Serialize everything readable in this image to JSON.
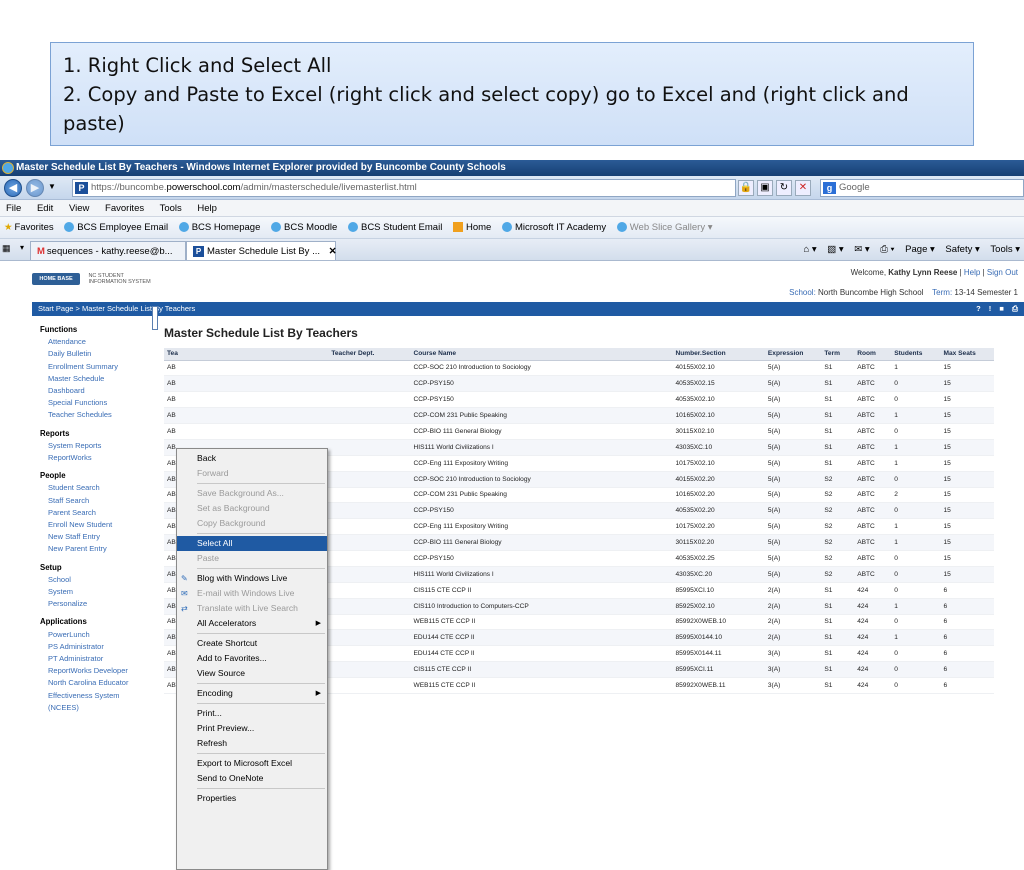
{
  "instructions": {
    "line1": "1.  Right Click and Select All",
    "line2": "2.  Copy and Paste to Excel  (right click and select copy) go to Excel and (right click and paste)"
  },
  "window": {
    "title": "Master Schedule List By Teachers - Windows Internet Explorer provided by Buncombe County Schools"
  },
  "address": {
    "url_scheme": "https://buncombe.",
    "url_host": "powerschool.com",
    "url_path": "/admin/masterschedule/livemasterlist.html",
    "search_placeholder": "Google"
  },
  "menubar": [
    "File",
    "Edit",
    "View",
    "Favorites",
    "Tools",
    "Help"
  ],
  "favorites": {
    "label": "Favorites",
    "items": [
      "BCS Employee Email",
      "BCS Homepage",
      "BCS Moodle",
      "BCS Student Email",
      "Home",
      "Microsoft IT Academy"
    ],
    "web_slice": "Web Slice Gallery ▾"
  },
  "tabs": [
    {
      "label": "sequences - kathy.reese@b..."
    },
    {
      "label": "Master Schedule List By ..."
    }
  ],
  "command_bar": [
    "Page ▾",
    "Safety ▾",
    "Tools ▾"
  ],
  "header": {
    "logo_badge": "HOME BASE",
    "logo_line1": "NC STUDENT",
    "logo_line2": "INFORMATION SYSTEM",
    "welcome_prefix": "Welcome,",
    "user_name": "Kathy Lynn Reese",
    "help": "Help",
    "sign_out": "Sign Out",
    "school_label": "School:",
    "school_name": "North Buncombe High School",
    "term_label": "Term:",
    "term_value": "13-14 Semester 1"
  },
  "breadcrumb": "Start Page > Master Schedule List By Teachers",
  "sidebar": [
    {
      "section": "Functions",
      "links": [
        "Attendance",
        "Daily Bulletin",
        "Enrollment Summary",
        "Master Schedule",
        "Dashboard",
        "Special Functions",
        "Teacher Schedules"
      ]
    },
    {
      "section": "Reports",
      "links": [
        "System Reports",
        "ReportWorks"
      ]
    },
    {
      "section": "People",
      "links": [
        "Student Search",
        "Staff Search",
        "Parent Search",
        "Enroll New Student",
        "New Staff Entry",
        "New Parent Entry"
      ]
    },
    {
      "section": "Setup",
      "links": [
        "School",
        "System",
        "Personalize"
      ]
    },
    {
      "section": "Applications",
      "links": [
        "PowerLunch",
        "PS Administrator",
        "PT Administrator",
        "ReportWorks Developer",
        "North Carolina Educator Effectiveness System (NCEES)"
      ]
    }
  ],
  "main": {
    "title": "Master Schedule List By Teachers",
    "columns": [
      "Tea",
      "Teacher Dept.",
      "Course Name",
      "Number.Section",
      "Expression",
      "Term",
      "Room",
      "Students",
      "Max Seats"
    ],
    "rows": [
      [
        "AB",
        "",
        "CCP-SOC 210 Introduction to Sociology",
        "40155X02.10",
        "5(A)",
        "S1",
        "ABTC",
        "1",
        "15"
      ],
      [
        "AB",
        "",
        "CCP-PSY150",
        "40535X02.15",
        "5(A)",
        "S1",
        "ABTC",
        "0",
        "15"
      ],
      [
        "AB",
        "",
        "CCP-PSY150",
        "40535X02.10",
        "5(A)",
        "S1",
        "ABTC",
        "0",
        "15"
      ],
      [
        "AB",
        "",
        "CCP-COM 231 Public Speaking",
        "10165X02.10",
        "5(A)",
        "S1",
        "ABTC",
        "1",
        "15"
      ],
      [
        "AB",
        "",
        "CCP-BIO 111 General Biology",
        "30115X02.10",
        "5(A)",
        "S1",
        "ABTC",
        "0",
        "15"
      ],
      [
        "AB",
        "",
        "HIS111 World Civilizations I",
        "43035XC.10",
        "5(A)",
        "S1",
        "ABTC",
        "1",
        "15"
      ],
      [
        "AB",
        "",
        "CCP-Eng 111 Expository Writing",
        "10175X02.10",
        "5(A)",
        "S1",
        "ABTC",
        "1",
        "15"
      ],
      [
        "AB",
        "",
        "CCP-SOC 210 Introduction to Sociology",
        "40155X02.20",
        "5(A)",
        "S2",
        "ABTC",
        "0",
        "15"
      ],
      [
        "AB",
        "",
        "CCP-COM 231 Public Speaking",
        "10165X02.20",
        "5(A)",
        "S2",
        "ABTC",
        "2",
        "15"
      ],
      [
        "AB",
        "",
        "CCP-PSY150",
        "40535X02.20",
        "5(A)",
        "S2",
        "ABTC",
        "0",
        "15"
      ],
      [
        "AB",
        "",
        "CCP-Eng 111 Expository Writing",
        "10175X02.20",
        "5(A)",
        "S2",
        "ABTC",
        "1",
        "15"
      ],
      [
        "AB",
        "",
        "CCP-BIO 111 General Biology",
        "30115X02.20",
        "5(A)",
        "S2",
        "ABTC",
        "1",
        "15"
      ],
      [
        "AB",
        "",
        "CCP-PSY150",
        "40535X02.25",
        "5(A)",
        "S2",
        "ABTC",
        "0",
        "15"
      ],
      [
        "AB",
        "",
        "HIS111 World Civilizations I",
        "43035XC.20",
        "5(A)",
        "S2",
        "ABTC",
        "0",
        "15"
      ],
      [
        "AB",
        "",
        "CIS115 CTE CCP II",
        "85995XCI.10",
        "2(A)",
        "S1",
        "424",
        "0",
        "6"
      ],
      [
        "AB",
        "",
        "CIS110 Introduction to Computers-CCP",
        "85925X02.10",
        "2(A)",
        "S1",
        "424",
        "1",
        "6"
      ],
      [
        "AB",
        "",
        "WEB115 CTE CCP II",
        "85992X0WEB.10",
        "2(A)",
        "S1",
        "424",
        "0",
        "6"
      ],
      [
        "AB",
        "",
        "EDU144 CTE CCP II",
        "85995X0144.10",
        "2(A)",
        "S1",
        "424",
        "1",
        "6"
      ],
      [
        "AB",
        "",
        "EDU144 CTE CCP II",
        "85995X0144.11",
        "3(A)",
        "S1",
        "424",
        "0",
        "6"
      ],
      [
        "AB",
        "",
        "CIS115 CTE CCP II",
        "85995XCI.11",
        "3(A)",
        "S1",
        "424",
        "0",
        "6"
      ],
      [
        "ABTech, CCP CTE Online",
        "",
        "WEB115 CTE CCP II",
        "85992X0WEB.11",
        "3(A)",
        "S1",
        "424",
        "0",
        "6"
      ]
    ]
  },
  "context_menu": [
    {
      "label": "Back",
      "state": "enabled"
    },
    {
      "label": "Forward",
      "state": "disabled"
    },
    {
      "sep": true
    },
    {
      "label": "Save Background As...",
      "state": "disabled"
    },
    {
      "label": "Set as Background",
      "state": "disabled"
    },
    {
      "label": "Copy Background",
      "state": "disabled"
    },
    {
      "sep": true
    },
    {
      "label": "Select All",
      "state": "selected"
    },
    {
      "label": "Paste",
      "state": "disabled"
    },
    {
      "sep": true
    },
    {
      "label": "Blog with Windows Live",
      "state": "enabled",
      "icon": "blog-icon"
    },
    {
      "label": "E-mail with Windows Live",
      "state": "disabled",
      "icon": "email-icon"
    },
    {
      "label": "Translate with Live Search",
      "state": "disabled",
      "icon": "translate-icon"
    },
    {
      "label": "All Accelerators",
      "state": "enabled",
      "submenu": true
    },
    {
      "sep": true
    },
    {
      "label": "Create Shortcut",
      "state": "enabled"
    },
    {
      "label": "Add to Favorites...",
      "state": "enabled"
    },
    {
      "label": "View Source",
      "state": "enabled"
    },
    {
      "sep": true
    },
    {
      "label": "Encoding",
      "state": "enabled",
      "submenu": true
    },
    {
      "sep": true
    },
    {
      "label": "Print...",
      "state": "enabled"
    },
    {
      "label": "Print Preview...",
      "state": "enabled"
    },
    {
      "label": "Refresh",
      "state": "enabled"
    },
    {
      "sep": true
    },
    {
      "label": "Export to Microsoft Excel",
      "state": "enabled"
    },
    {
      "label": "Send to OneNote",
      "state": "enabled"
    },
    {
      "sep": true
    },
    {
      "label": "Properties",
      "state": "enabled"
    }
  ]
}
